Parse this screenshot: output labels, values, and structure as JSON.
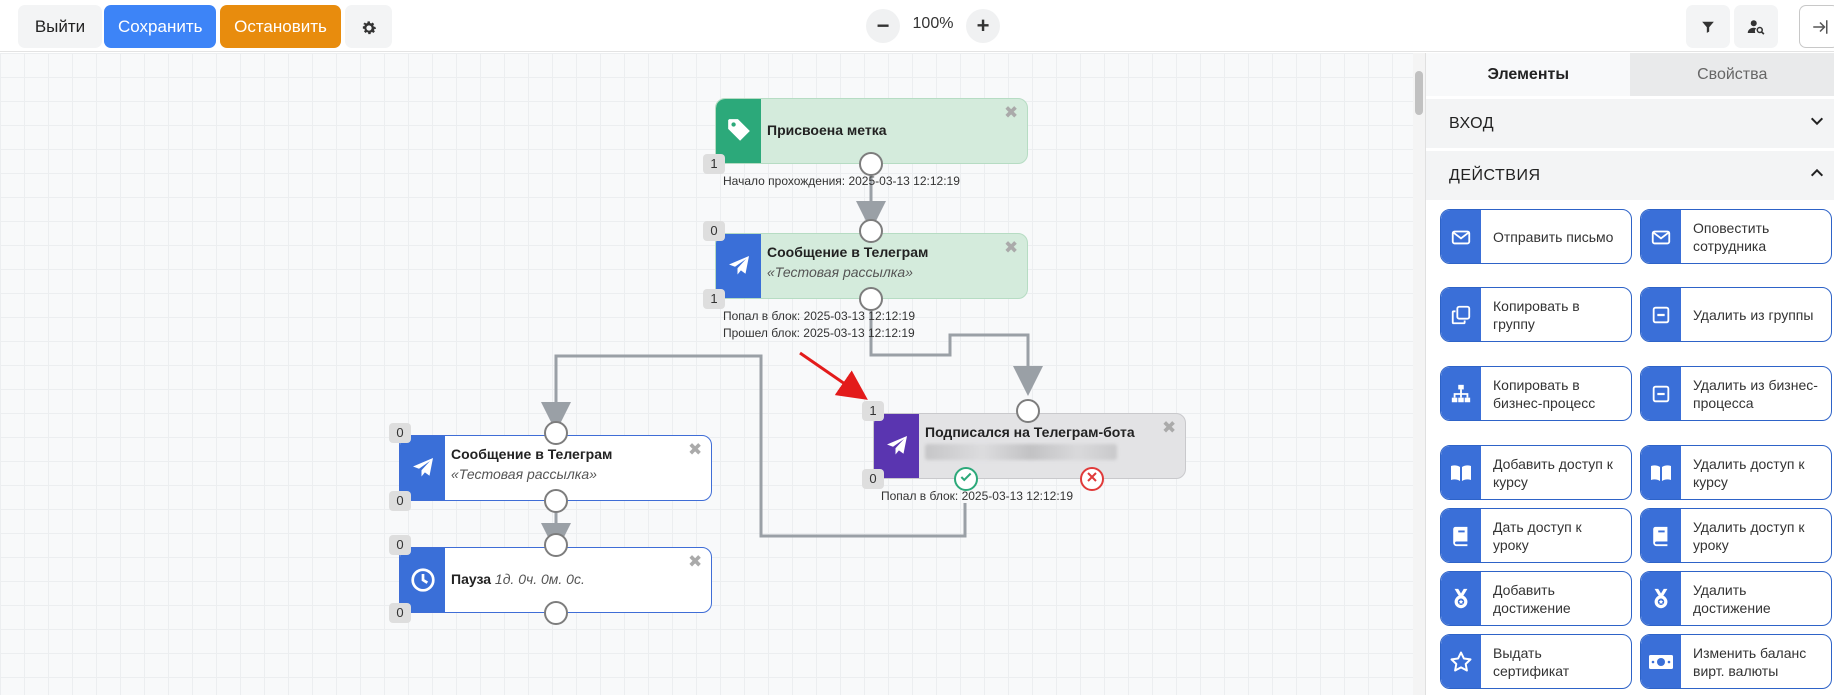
{
  "toolbar": {
    "exit_label": "Выйти",
    "save_label": "Сохранить",
    "stop_label": "Остановить",
    "zoom_value": "100%"
  },
  "colors": {
    "save": "#3d84f7",
    "stop": "#e88c0d",
    "tag_node": "#2ca97a",
    "telegram_node": "#3a6fd8",
    "condition_node": "#5a35b0",
    "arrow": "#e31b1b"
  },
  "canvas": {
    "nodes": [
      {
        "id": "tag",
        "title": "Присвоена метка",
        "subtitle": "",
        "icon": "tag-icon",
        "count_out": "1",
        "info": [
          "Начало прохождения: 2025-03-13 12:12:19"
        ]
      },
      {
        "id": "tg1",
        "title": "Сообщение в Телеграм",
        "subtitle": "«Тестовая рассылка»",
        "icon": "paper-plane-icon",
        "count_in": "0",
        "count_out": "1",
        "info": [
          "Попал в блок: 2025-03-13 12:12:19",
          "Прошел блок: 2025-03-13 12:12:19"
        ]
      },
      {
        "id": "sub",
        "title": "Подписался на Телеграм-бота",
        "subtitle": "",
        "icon": "paper-plane-icon",
        "count_in": "1",
        "count_out": "0",
        "info": [
          "Попал в блок: 2025-03-13 12:12:19"
        ]
      },
      {
        "id": "tg2",
        "title": "Сообщение в Телеграм",
        "subtitle": "«Тестовая рассылка»",
        "icon": "paper-plane-icon",
        "count_in": "0",
        "count_out": "0"
      },
      {
        "id": "pause",
        "title": "Пауза",
        "subtitle": "1д. 0ч. 0м. 0с.",
        "icon": "clock-icon",
        "count_in": "0",
        "count_out": "0"
      }
    ]
  },
  "panel": {
    "tabs": [
      {
        "label": "Элементы",
        "active": true
      },
      {
        "label": "Свойства",
        "active": false
      }
    ],
    "sections": [
      {
        "label": "ВХОД",
        "expanded": false
      },
      {
        "label": "ДЕЙСТВИЯ",
        "expanded": true
      }
    ],
    "actions": [
      {
        "label": "Отправить письмо",
        "icon": "envelope-icon"
      },
      {
        "label": "Оповестить сотрудника",
        "icon": "envelope-icon"
      },
      {
        "label": "Копировать в группу",
        "icon": "copy-icon"
      },
      {
        "label": "Удалить из группы",
        "icon": "minus-box-icon"
      },
      {
        "label": "Копировать в бизнес-процесс",
        "icon": "hierarchy-icon"
      },
      {
        "label": "Удалить из бизнес-процесса",
        "icon": "minus-box-icon"
      },
      {
        "label": "Добавить доступ к курсу",
        "icon": "book-open-icon"
      },
      {
        "label": "Удалить доступ к курсу",
        "icon": "book-open-icon"
      },
      {
        "label": "Дать доступ к уроку",
        "icon": "book-icon"
      },
      {
        "label": "Удалить доступ к уроку",
        "icon": "book-icon"
      },
      {
        "label": "Добавить достижение",
        "icon": "medal-icon"
      },
      {
        "label": "Удалить достижение",
        "icon": "medal-icon"
      },
      {
        "label": "Выдать сертификат",
        "icon": "star-icon"
      },
      {
        "label": "Изменить баланс вирт. валюты",
        "icon": "banknote-icon"
      }
    ]
  }
}
